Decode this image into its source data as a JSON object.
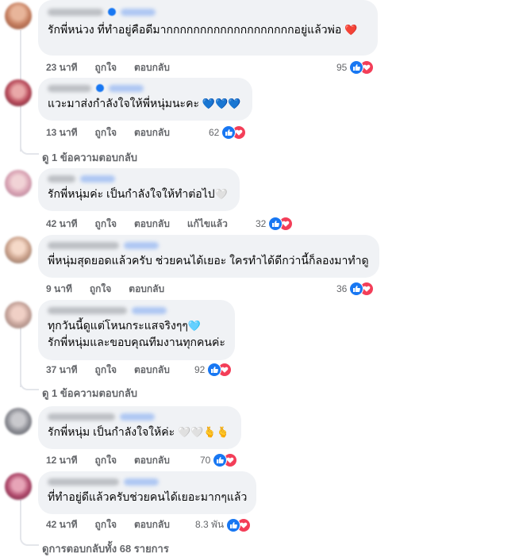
{
  "comments": [
    {
      "text": "รักพี่หน่วง ที่ทำอยู่คือดีมากกกกกกกกกกกกกกกกกกกอยู่แล้วพ่อ",
      "emoji": "❤️",
      "time": "23 นาที",
      "like": "ถูกใจ",
      "reply": "ตอบกลับ",
      "count": "95"
    },
    {
      "text": "แวะมาส่งกำลังใจให้พี่หนุ่มนะคะ",
      "emoji": "💙💙💙",
      "time": "13 นาที",
      "like": "ถูกใจ",
      "reply": "ตอบกลับ",
      "count": "62",
      "view_replies": "ดู 1 ข้อความตอบกลับ"
    },
    {
      "text": "รักพี่หนุ่มค่ะ เป็นกำลังใจให้ทำต่อไป",
      "emoji": "🤍",
      "time": "42 นาที",
      "like": "ถูกใจ",
      "reply": "ตอบกลับ",
      "edited": "แก้ไขแล้ว",
      "count": "32"
    },
    {
      "text": "พี่หนุ่มสุดยอดแล้วครับ ช่วยคนได้เยอะ ใครทำได้ดีกว่านี้ก็ลองมาทำดู",
      "time": "9 นาที",
      "like": "ถูกใจ",
      "reply": "ตอบกลับ",
      "count": "36"
    },
    {
      "text": "ทุกวันนี้ดูแต่โหนกระแสจริงๆๆ",
      "emoji": "🩵",
      "text2": "รักพี่หนุ่มและขอบคุณทีมงานทุกคนค่ะ",
      "time": "37 นาที",
      "like": "ถูกใจ",
      "reply": "ตอบกลับ",
      "count": "92",
      "view_replies": "ดู 1 ข้อความตอบกลับ"
    },
    {
      "text": "รักพี่หนุ่ม เป็นกำลังใจให้ค่ะ",
      "emoji": "🤍🤍🫰🫰",
      "time": "12 นาที",
      "like": "ถูกใจ",
      "reply": "ตอบกลับ",
      "count": "70"
    },
    {
      "text": "ที่ทำอยู่ดีแล้วครับช่วยคนได้เยอะมากๆแล้ว",
      "time": "42 นาที",
      "like": "ถูกใจ",
      "reply": "ตอบกลับ",
      "count": "8.3 พัน"
    }
  ],
  "footer": {
    "view_all": "ดูการตอบกลับทั้ง 68 รายการ"
  },
  "colors": {
    "like": "#1877f2",
    "love": "#f33e58",
    "bubble": "#f0f2f5",
    "meta": "#65676b"
  },
  "icons": {
    "like": "thumbs-up-icon",
    "love": "heart-icon"
  }
}
